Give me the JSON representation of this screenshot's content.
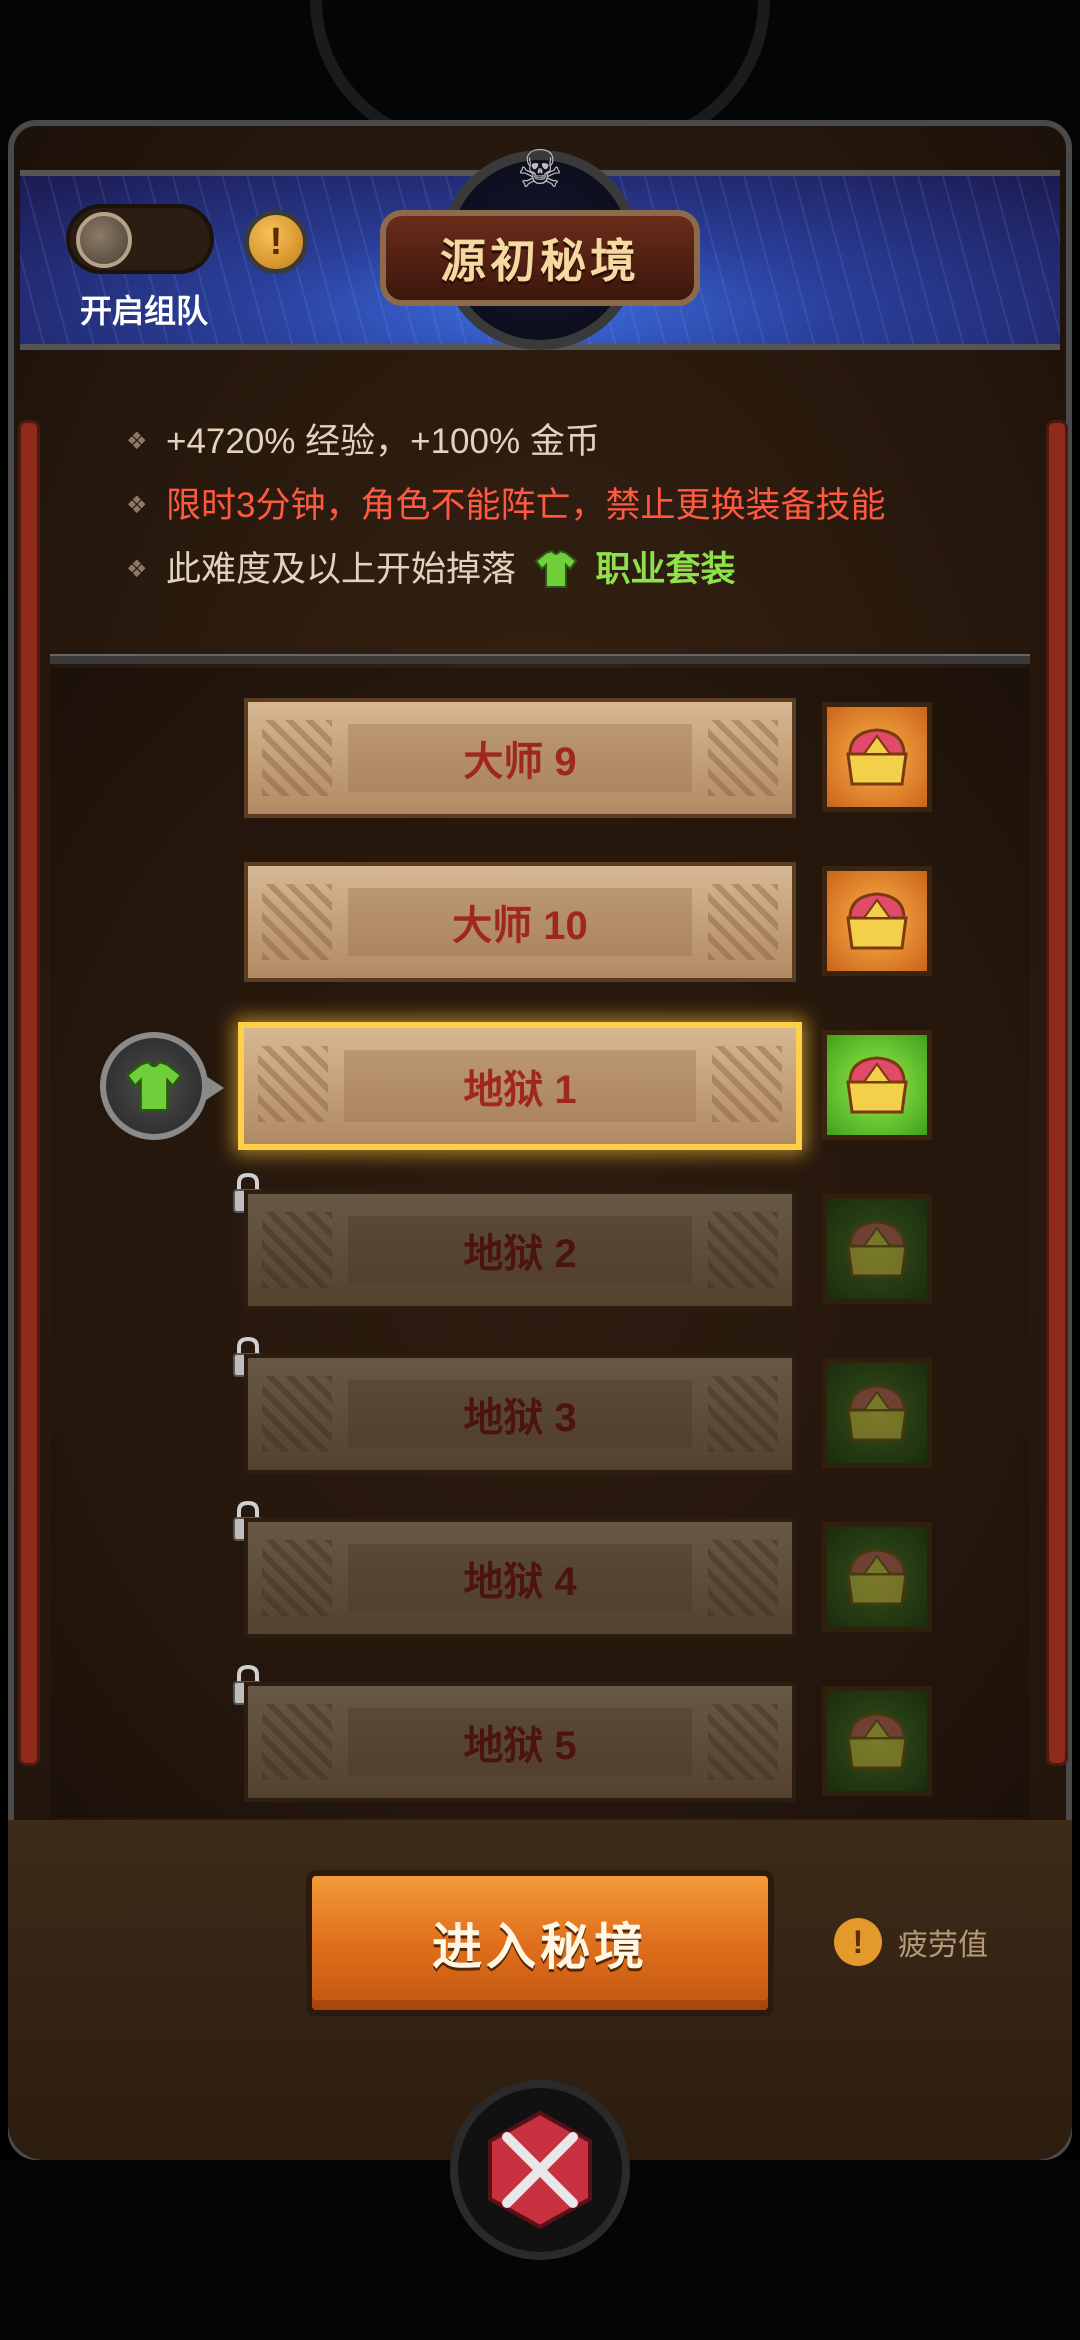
{
  "header": {
    "title": "源初秘境",
    "team_toggle_label": "开启组队",
    "team_toggle_on": false,
    "info_icon": "!"
  },
  "rules": [
    {
      "text": "+4720% 经验，+100% 金币",
      "color": "#e2d3bf"
    },
    {
      "text": "限时3分钟，角色不能阵亡，禁止更换装备技能",
      "color": "#ff5a40"
    },
    {
      "prefix": "此难度及以上开始掉落",
      "suffix": "职业套装",
      "suffix_color": "#8fe04a"
    }
  ],
  "levels": [
    {
      "label": "大师 9",
      "state": "unlocked",
      "reward": "orange-chest"
    },
    {
      "label": "大师 10",
      "state": "unlocked",
      "reward": "orange-chest"
    },
    {
      "label": "地狱 1",
      "state": "current",
      "reward": "green-chest"
    },
    {
      "label": "地狱 2",
      "state": "locked",
      "reward": "green-chest"
    },
    {
      "label": "地狱 3",
      "state": "locked",
      "reward": "green-chest"
    },
    {
      "label": "地狱 4",
      "state": "locked",
      "reward": "green-chest"
    },
    {
      "label": "地狱 5",
      "state": "locked",
      "reward": "green-chest"
    }
  ],
  "enter_button": "进入秘境",
  "fatigue": {
    "icon": "!",
    "label": "疲劳值"
  },
  "icons": {
    "current_marker": "armor-icon",
    "lock": "lock-icon",
    "chest": "chest-icon",
    "bottom": "crossed-swords-icon",
    "title_crest": "skull-icon"
  },
  "colors": {
    "accent_orange": "#e0701c",
    "highlight_gold": "#ffcf4a",
    "warning_red": "#ff5a40",
    "suit_green": "#8fe04a"
  }
}
